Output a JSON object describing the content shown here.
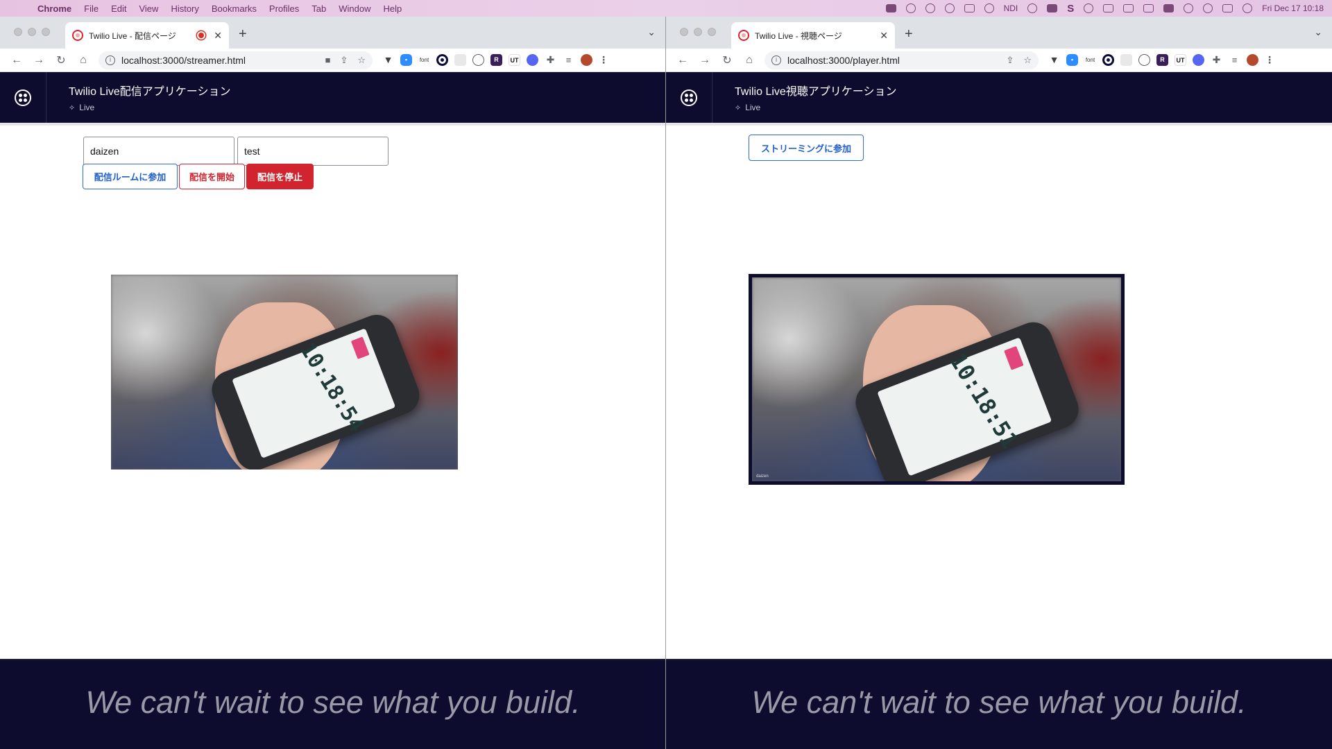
{
  "menubar": {
    "app": "Chrome",
    "items": [
      "File",
      "Edit",
      "View",
      "History",
      "Bookmarks",
      "Profiles",
      "Tab",
      "Window",
      "Help"
    ],
    "ndi": "NDI",
    "datetime": "Fri Dec 17  10:18"
  },
  "streamer": {
    "tab_title": "Twilio Live - 配信ページ",
    "url": "localhost:3000/streamer.html",
    "app_title": "Twilio Live配信アプリケーション",
    "app_sub": "Live",
    "name_input": "daizen",
    "room_input": "test",
    "join_button": "配信ルームに参加",
    "start_button": "配信を開始",
    "stop_button": "配信を停止",
    "clock": "10:18:54",
    "footer": "We can't wait to see what you build."
  },
  "player": {
    "tab_title": "Twilio Live - 視聴ページ",
    "url": "localhost:3000/player.html",
    "app_title": "Twilio Live視聴アプリケーション",
    "app_sub": "Live",
    "join_button": "ストリーミングに参加",
    "clock": "10:18:51",
    "video_label": "daizen",
    "footer": "We can't wait to see what you build."
  },
  "extensions": {
    "font_label": "font"
  }
}
